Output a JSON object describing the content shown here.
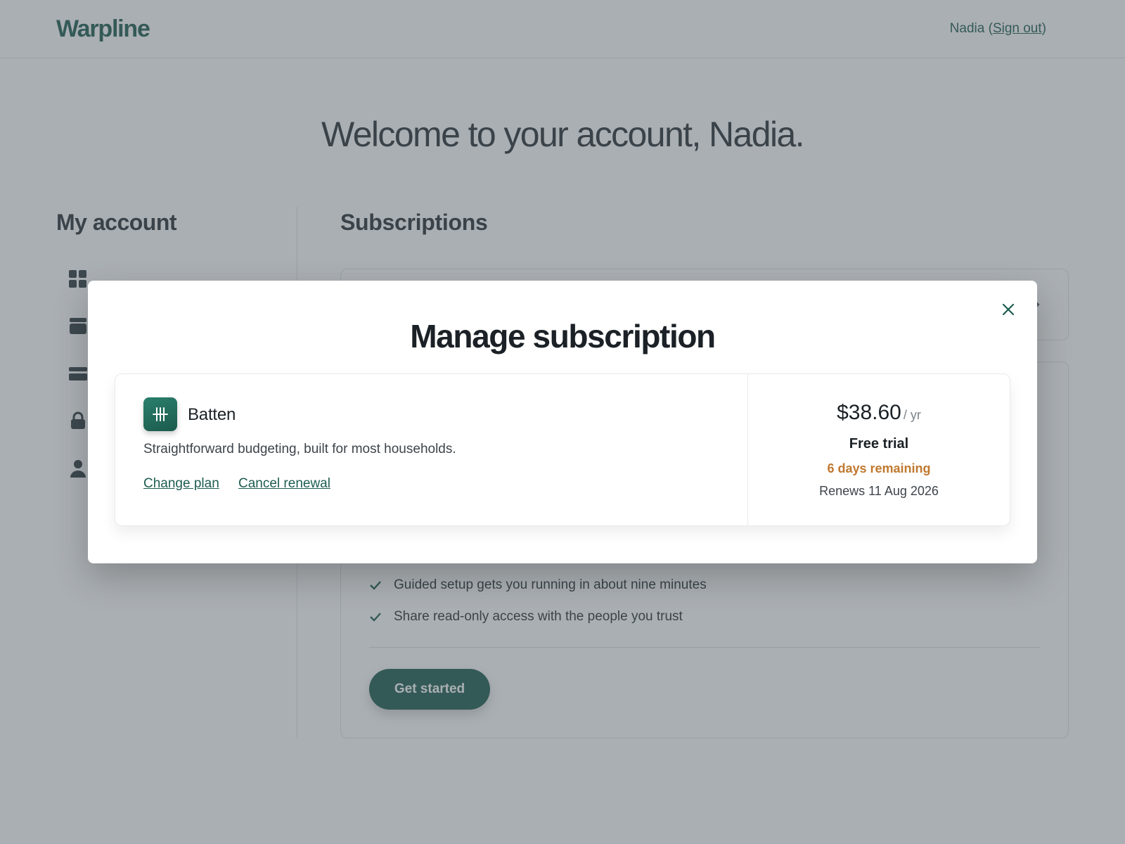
{
  "header": {
    "brand": "Warpline",
    "user_name": "Nadia",
    "open_paren": " (",
    "sign_out": "Sign out",
    "close_paren": ")"
  },
  "welcome": "Welcome to your account, Nadia.",
  "sidebar": {
    "title": "My account",
    "icons": [
      "dashboard-icon",
      "archive-icon",
      "credit-card-icon",
      "lock-icon",
      "user-icon"
    ]
  },
  "subscriptions": {
    "title": "Subscriptions",
    "features": [
      "Guided setup gets you running in about nine minutes",
      "Share read-only access with the people you trust"
    ],
    "cta": "Get started"
  },
  "modal": {
    "title": "Manage subscription",
    "plan": {
      "name": "Batten",
      "description": "Straightforward budgeting, built for most households.",
      "change_plan": "Change plan",
      "cancel_renewal": "Cancel renewal",
      "price": "$38.60",
      "period": "/ yr",
      "status": "Free trial",
      "remaining": "6 days remaining",
      "renews": "Renews 11 Aug 2026"
    }
  },
  "colors": {
    "brand": "#1d5c4f",
    "warning": "#c0782e",
    "overlay": "rgba(78,88,96,0.48)"
  }
}
